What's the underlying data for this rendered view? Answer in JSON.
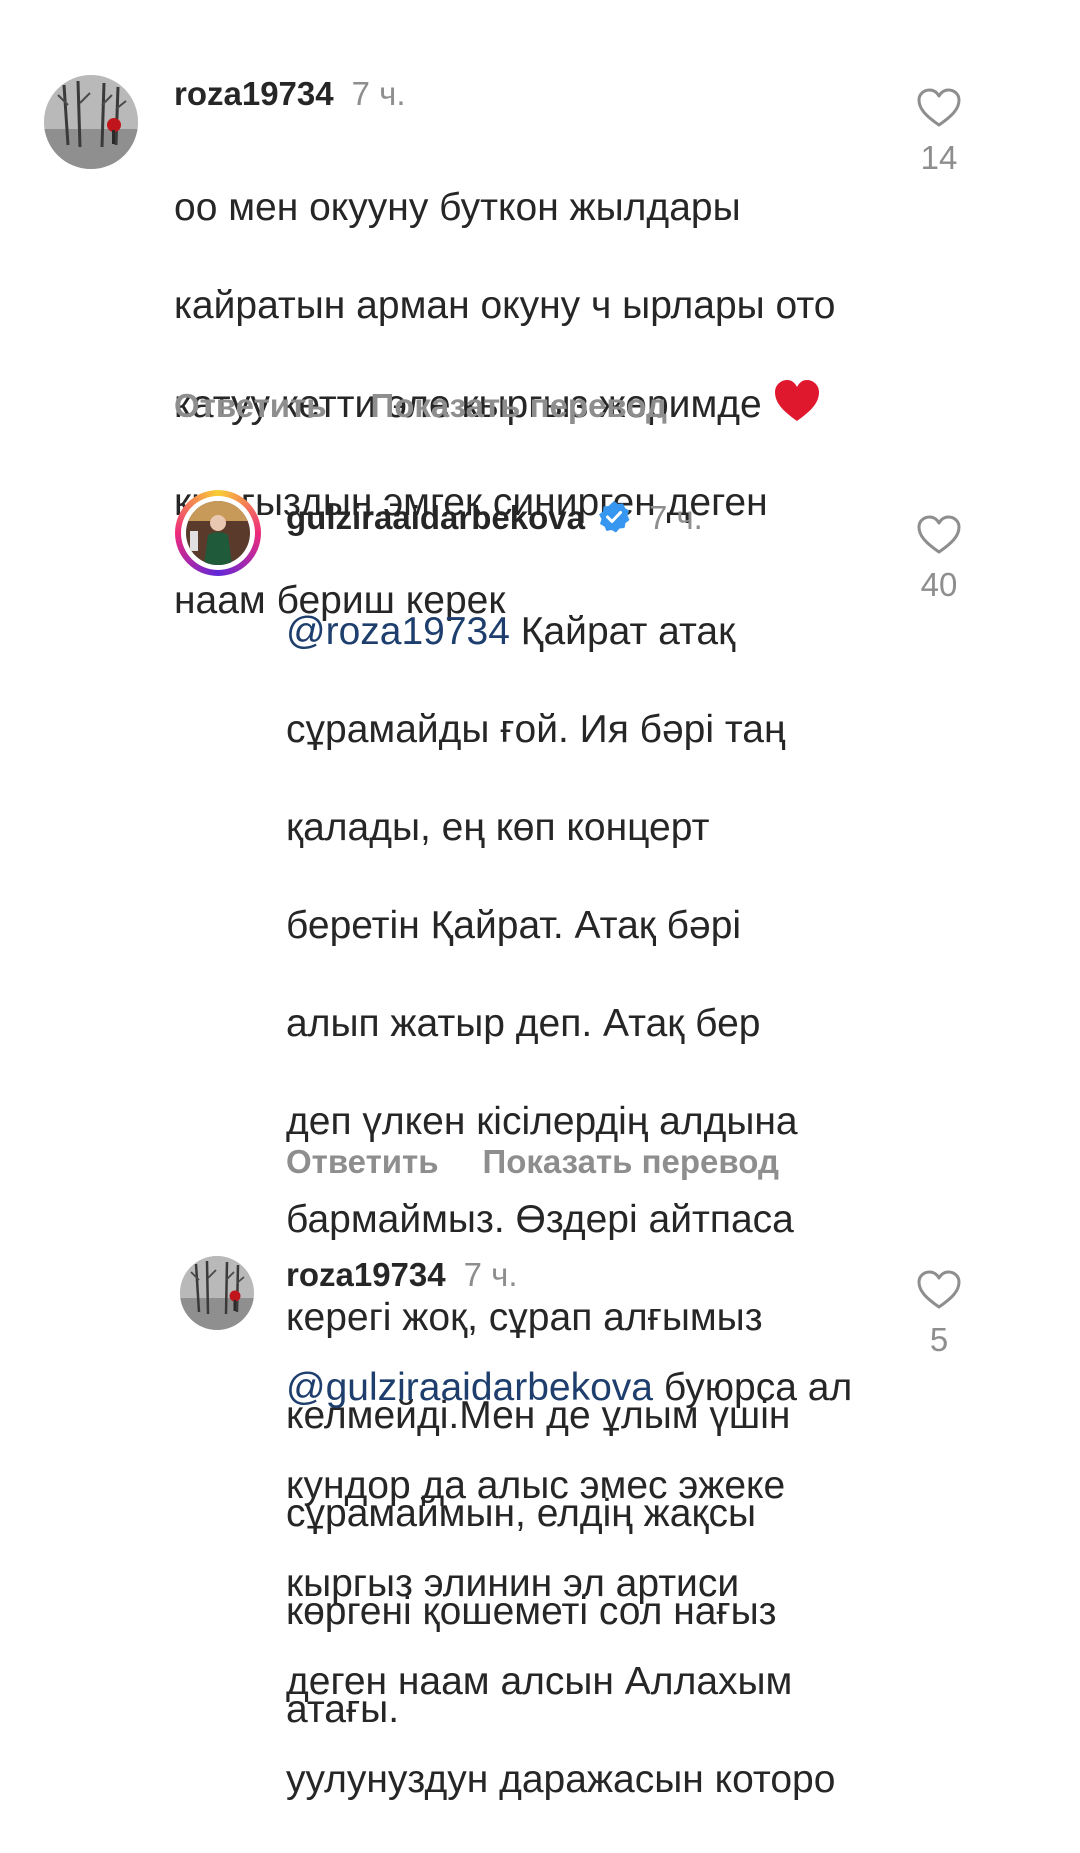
{
  "comments": [
    {
      "username": "roza19734",
      "time": "7 ч.",
      "text_lines": [
        "оо мен окууну буткон жылдары",
        "кайратын арман окуну ч ырлары ото",
        "катуу кетти эле кыргыз жеримде",
        "кыргыздын эмгек синирген деген",
        "наам бериш керек"
      ],
      "emoji": "red-heart",
      "likes": "14",
      "reply_label": "Ответить",
      "translate_label": "Показать перевод"
    },
    {
      "username": "gulziraaidarbekova",
      "verified": true,
      "time": "7 ч.",
      "mention": "@roza19734",
      "first_line": "Қайрат атақ",
      "text_lines": [
        "сұрамайды ғой. Ия бәрі таң",
        "қалады, ең көп концерт",
        "беретін Қайрат. Атақ бәрі",
        "алып жатыр деп. Атақ бер",
        "деп үлкен кісілердің алдына",
        "бармаймыз. Өздері айтпаса",
        "керегі жоқ, сұрап алғымыз",
        "келмейді.Мен де ұлым үшін",
        "сұрамаймын, елдің жақсы",
        "көргені қошеметі сол нағыз",
        "атағы."
      ],
      "likes": "40",
      "reply_label": "Ответить",
      "translate_label": "Показать перевод"
    },
    {
      "username": "roza19734",
      "time": "7 ч.",
      "mention": "@gulziraaidarbekova",
      "first_line": "буюрса ал",
      "text_lines": [
        "кундор да алыс эмес эжеке",
        "кыргыз элинин эл артиси",
        "деген наам алсын Аллахым",
        "уулунуздун даражасын которо"
      ],
      "likes": "5"
    }
  ],
  "colors": {
    "text": "#262626",
    "muted": "#8e8e8e",
    "mention": "#1e3f6e",
    "verified": "#3797f0",
    "heart_emoji": "#e0182d"
  },
  "icons": {
    "like": "heart-outline-icon",
    "verified": "verified-badge-icon",
    "emoji": "red-heart-emoji"
  }
}
